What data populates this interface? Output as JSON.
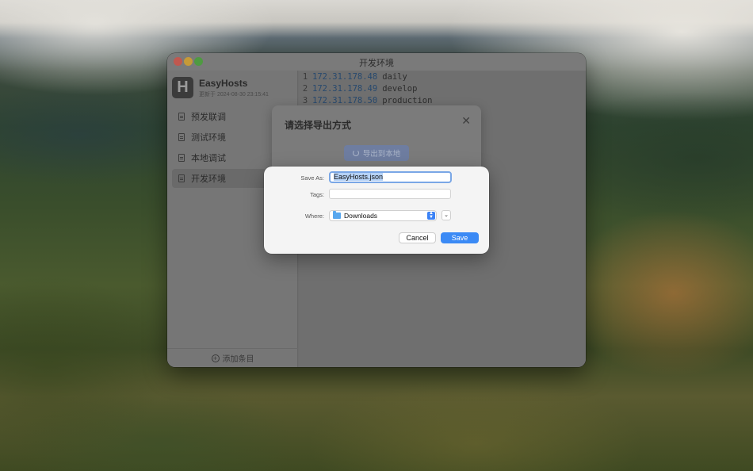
{
  "window": {
    "title": "开发环境"
  },
  "app": {
    "name": "EasyHosts",
    "updated": "更新于 2024-08-30 23:15:41",
    "logo_letter": "H"
  },
  "sidebar": {
    "items": [
      {
        "label": "预发联调",
        "icon": "document-icon",
        "active": false
      },
      {
        "label": "测试环境",
        "icon": "document-icon",
        "active": false
      },
      {
        "label": "本地调试",
        "icon": "document-icon",
        "active": false
      },
      {
        "label": "开发环境",
        "icon": "document-icon",
        "active": true
      }
    ],
    "add_entry_label": "添加条目"
  },
  "editor": {
    "lines": [
      {
        "no": "1",
        "ip": "172.31.178.48",
        "host": "daily"
      },
      {
        "no": "2",
        "ip": "172.31.178.49",
        "host": "develop"
      },
      {
        "no": "3",
        "ip": "172.31.178.50",
        "host": "production"
      }
    ]
  },
  "export_dialog": {
    "title": "请选择导出方式",
    "close_glyph": "✕",
    "local_button_label": "导出到本地"
  },
  "save_sheet": {
    "save_as_label": "Save As:",
    "save_as_value": "EasyHosts.json",
    "tags_label": "Tags:",
    "where_label": "Where:",
    "where_value": "Downloads",
    "cancel_label": "Cancel",
    "save_label": "Save"
  },
  "colors": {
    "accent": "#3b8af5"
  }
}
